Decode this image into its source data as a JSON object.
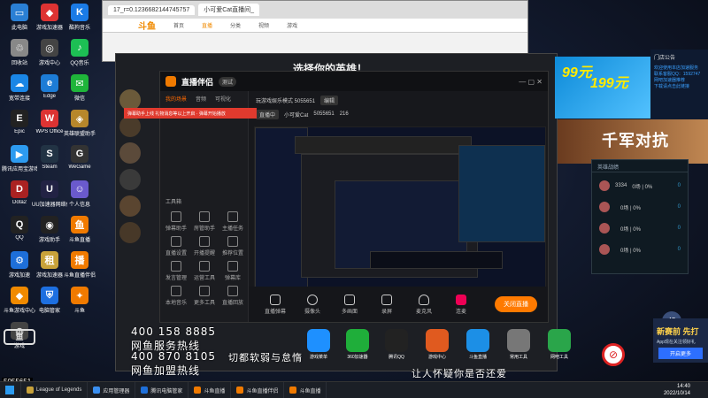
{
  "desktop_icons": [
    {
      "label": "此电脑",
      "color": "#2a7fd4",
      "glyph": "▭",
      "icon": "computer-icon"
    },
    {
      "label": "游戏加速器",
      "color": "#d33",
      "glyph": "◆",
      "icon": "game-booster-icon"
    },
    {
      "label": "酷狗音乐",
      "color": "#1b7be6",
      "glyph": "K",
      "icon": "kugou-icon"
    },
    {
      "label": "回收站",
      "color": "#888",
      "glyph": "♲",
      "icon": "recycle-bin-icon"
    },
    {
      "label": "游戏中心",
      "color": "#444",
      "glyph": "◎",
      "icon": "game-center-icon"
    },
    {
      "label": "QQ音乐",
      "color": "#1dbf54",
      "glyph": "♪",
      "icon": "qq-music-icon"
    },
    {
      "label": "宽带连接",
      "color": "#1a86e6",
      "glyph": "☁",
      "icon": "broadband-icon"
    },
    {
      "label": "Edge",
      "color": "#1d7cd6",
      "glyph": "e",
      "icon": "edge-icon"
    },
    {
      "label": "微信",
      "color": "#1fb53a",
      "glyph": "✉",
      "icon": "wechat-icon"
    },
    {
      "label": "Epic",
      "color": "#222",
      "glyph": "E",
      "icon": "epic-icon"
    },
    {
      "label": "WPS Office",
      "color": "#d33",
      "glyph": "W",
      "icon": "wps-icon"
    },
    {
      "label": "英雄联盟助手",
      "color": "#b7872b",
      "glyph": "◈",
      "icon": "lol-helper-icon"
    },
    {
      "label": "腾讯应用宝游戏",
      "color": "#2d9bf0",
      "glyph": "▶",
      "icon": "app-store-icon"
    },
    {
      "label": "Steam",
      "color": "#234",
      "glyph": "S",
      "icon": "steam-icon"
    },
    {
      "label": "WeGame",
      "color": "#333",
      "glyph": "G",
      "icon": "wegame-icon"
    },
    {
      "label": "Dota2",
      "color": "#a22",
      "glyph": "D",
      "icon": "dota2-icon"
    },
    {
      "label": "UU加速器网络优化",
      "color": "#224",
      "glyph": "U",
      "icon": "uu-icon"
    },
    {
      "label": "个人信息",
      "color": "#6a5acd",
      "glyph": "☺",
      "icon": "profile-icon"
    },
    {
      "label": "QQ",
      "color": "#222",
      "glyph": "Q",
      "icon": "qq-icon"
    },
    {
      "label": "游戏助手",
      "color": "#222",
      "glyph": "◉",
      "icon": "game-helper-icon"
    },
    {
      "label": "斗鱼直播",
      "color": "#f07a00",
      "glyph": "鱼",
      "icon": "douyu-icon"
    },
    {
      "label": "游戏加速",
      "color": "#1e6fd9",
      "glyph": "⚙",
      "icon": "accelerator-icon"
    },
    {
      "label": "游戏加速器",
      "color": "#c8a23a",
      "glyph": "租",
      "icon": "rental-icon"
    },
    {
      "label": "斗鱼直播伴侣",
      "color": "#f07a00",
      "glyph": "播",
      "icon": "companion-icon"
    },
    {
      "label": "斗鱼游戏中心",
      "color": "#f08a00",
      "glyph": "◆",
      "icon": "douyu-game-icon"
    },
    {
      "label": "电脑管家",
      "color": "#1d6fe0",
      "glyph": "⛨",
      "icon": "pc-manager-icon"
    },
    {
      "label": "斗鱼",
      "color": "#f07a00",
      "glyph": "✦",
      "icon": "douyu-fish-icon"
    },
    {
      "label": "游戏",
      "color": "#444",
      "glyph": "◍",
      "icon": "game-icon"
    }
  ],
  "browser": {
    "tabs": [
      "17_r=0.1236682144745757",
      "小可爱Cat直播间_"
    ],
    "site": "斗鱼",
    "nav": [
      "首页",
      "直播",
      "分类",
      "视频",
      "游戏"
    ],
    "banner": "选择你的英雄！"
  },
  "companion": {
    "title": "直播伴侣",
    "beta": "测试",
    "left_tabs": [
      "我的场景",
      "音频",
      "可视化"
    ],
    "scene": "场景 1",
    "tools_header": "工具箱",
    "tools": [
      "弹幕助手",
      "房管助手",
      "主播任务",
      "直播设置",
      "开播提醒",
      "推荐位置",
      "发言管理",
      "运营工具",
      "弹幕库",
      "本地音乐",
      "更多工具",
      "直播回放"
    ],
    "room_title": "玩游戏娱乐模式 5055651",
    "room_tag": "编辑",
    "info_tag": "直播中",
    "viewer": "小可爱Cat",
    "room_id": "5055651",
    "count": "216",
    "notice": "弹幕助手上线  礼物消息等以上开启 · 弹幕开始播放",
    "bottom_buttons": [
      "直播弹幕",
      "摄像头",
      "多画面",
      "录屏",
      "麦克风",
      "连麦"
    ],
    "go_live": "关闭直播",
    "time": "00:00:00"
  },
  "right": {
    "ad_price": "99元",
    "ad_price2": "199元",
    "notice_title": "门店公告",
    "notice_lines": [
      "欢迎使用本店加速服务",
      "联系客服QQ：1592747",
      "网吧加速器推荐",
      "下载请点击此链接"
    ],
    "ward_text": "千军对抗",
    "assist_title": "英雄战绩",
    "assist_rows": [
      {
        "name": "3334",
        "stat": "0场 | 0%",
        "value": "0"
      },
      {
        "name": "",
        "stat": "0场 | 0%",
        "value": "0"
      },
      {
        "name": "",
        "stat": "0场 | 0%",
        "value": "0"
      },
      {
        "name": "",
        "stat": "0场 | 0%",
        "value": "0"
      }
    ],
    "level": "45",
    "news_title": "新赛前 先打",
    "news_sub": "App现在关注领好礼",
    "news_btn": "开启更多"
  },
  "bottom_apps": [
    {
      "label": "游戏菜单",
      "color": "#1e90ff"
    },
    {
      "label": "360加速器",
      "color": "#1fae3a"
    },
    {
      "label": "腾讯QQ",
      "color": "#222"
    },
    {
      "label": "游戏中心",
      "color": "#e05a1f"
    },
    {
      "label": "斗鱼直播",
      "color": "#1c8fe6"
    },
    {
      "label": "常用工具",
      "color": "#777"
    },
    {
      "label": "网吧工具",
      "color": "#2aa54a"
    }
  ],
  "overlay": {
    "hotline1_num": "400 158 8885",
    "hotline1_label": "网鱼服务热线",
    "hotline2_num": "400 870 8105",
    "hotline2_label": "网鱼加盟热线",
    "slogan1": "切都软弱与怠惰",
    "slogan2": "让人怀疑你是否还爱",
    "watermark_room": "5055651"
  },
  "taskbar": {
    "items": [
      "League of Legends",
      "应用管理器",
      "腾讯电脑管家",
      "斗鱼直播",
      "斗鱼直播伴侣",
      "斗鱼直播"
    ],
    "time": "14:40",
    "date": "2022/10/14"
  }
}
